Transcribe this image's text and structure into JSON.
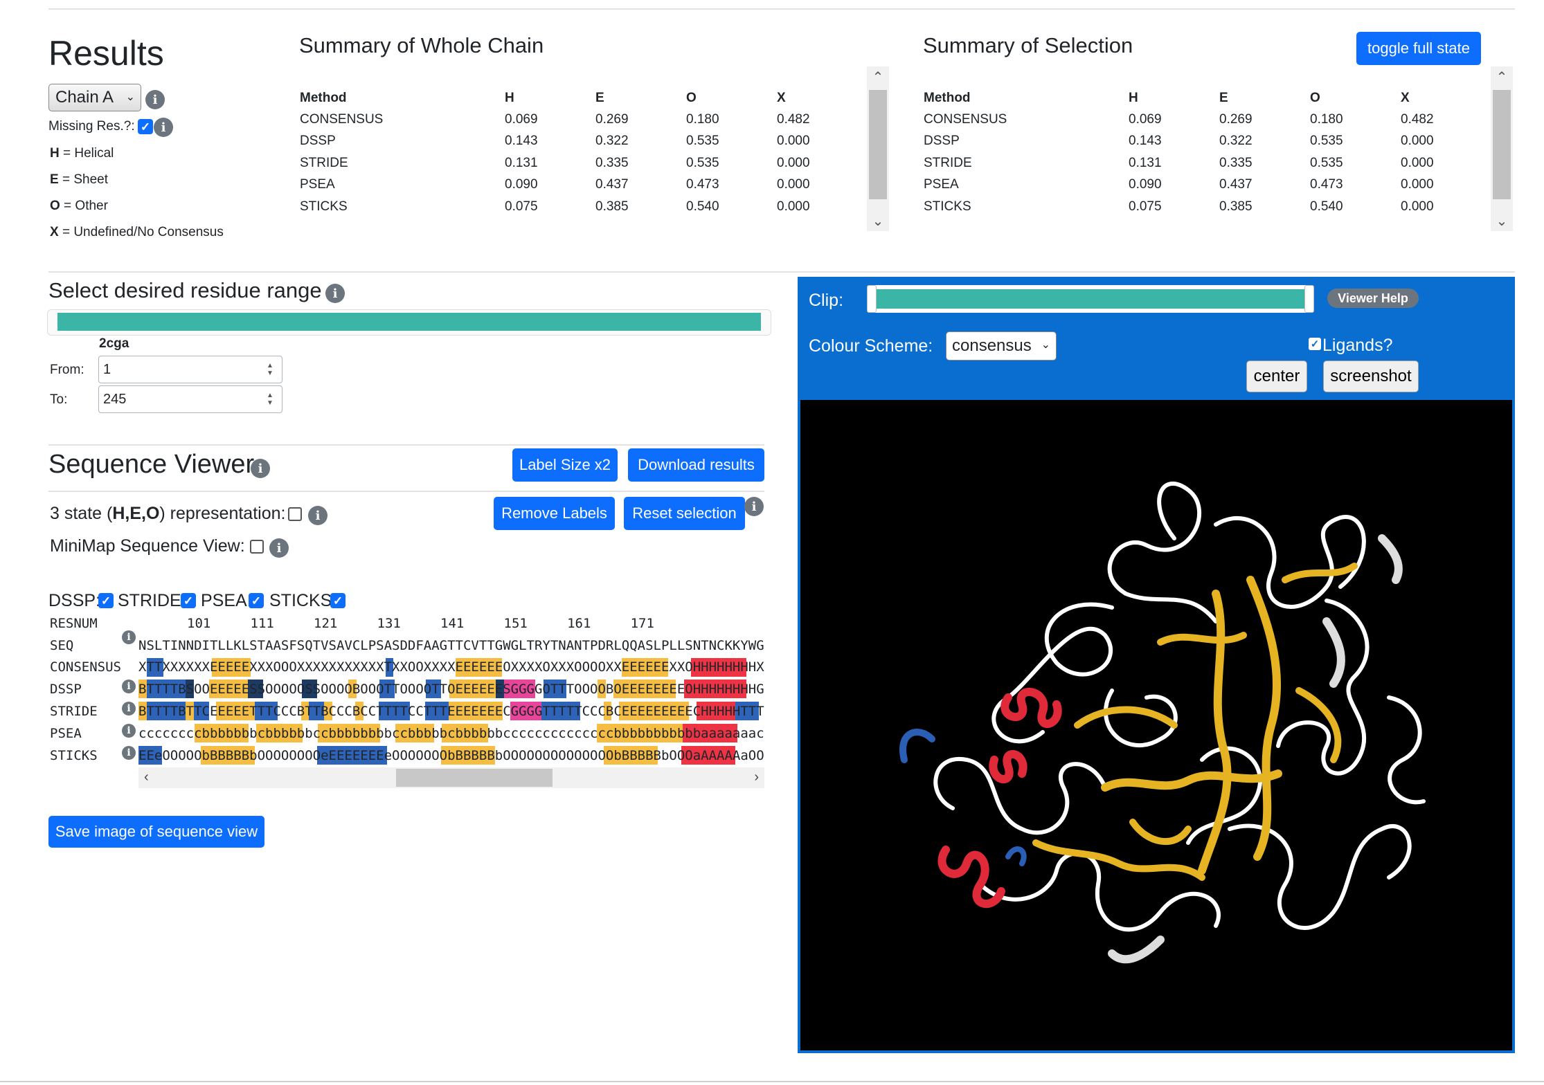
{
  "results": {
    "title": "Results",
    "chain_select": "Chain A",
    "missing_res_label": "Missing Res.?:",
    "legend": [
      {
        "key": "H",
        "text": " = Helical"
      },
      {
        "key": "E",
        "text": " = Sheet"
      },
      {
        "key": "O",
        "text": " = Other"
      },
      {
        "key": "X",
        "text": " = Undefined/No Consensus"
      }
    ]
  },
  "summary_whole": {
    "title": "Summary of Whole Chain",
    "headers": [
      "Method",
      "H",
      "E",
      "O",
      "X"
    ],
    "rows": [
      [
        "CONSENSUS",
        "0.069",
        "0.269",
        "0.180",
        "0.482"
      ],
      [
        "DSSP",
        "0.143",
        "0.322",
        "0.535",
        "0.000"
      ],
      [
        "STRIDE",
        "0.131",
        "0.335",
        "0.535",
        "0.000"
      ],
      [
        "PSEA",
        "0.090",
        "0.437",
        "0.473",
        "0.000"
      ],
      [
        "STICKS",
        "0.075",
        "0.385",
        "0.540",
        "0.000"
      ]
    ]
  },
  "summary_selection": {
    "title": "Summary of Selection",
    "toggle_label": "toggle full state",
    "headers": [
      "Method",
      "H",
      "E",
      "O",
      "X"
    ],
    "rows": [
      [
        "CONSENSUS",
        "0.069",
        "0.269",
        "0.180",
        "0.482"
      ],
      [
        "DSSP",
        "0.143",
        "0.322",
        "0.535",
        "0.000"
      ],
      [
        "STRIDE",
        "0.131",
        "0.335",
        "0.535",
        "0.000"
      ],
      [
        "PSEA",
        "0.090",
        "0.437",
        "0.473",
        "0.000"
      ],
      [
        "STICKS",
        "0.075",
        "0.385",
        "0.540",
        "0.000"
      ]
    ]
  },
  "range": {
    "title": "Select desired residue range",
    "chain_id": "2cga",
    "from_label": "From:",
    "from_value": "1",
    "to_label": "To:",
    "to_value": "245"
  },
  "sequence_viewer": {
    "title": "Sequence Viewer",
    "label_size_btn": "Label Size x2",
    "download_btn": "Download results",
    "three_state_prefix": "3 state (",
    "three_state_bold": "H,E,O",
    "three_state_suffix": ") representation:",
    "remove_labels_btn": "Remove Labels",
    "reset_selection_btn": "Reset selection",
    "minimap_label": "MiniMap Sequence View:",
    "method_toggles": [
      "DSSP:",
      "STRIDE:",
      "PSEA:",
      "STICKS:"
    ],
    "resnum_label": "RESNUM",
    "resnum_line": "101     111     121     131     141     151     161     171",
    "seq_label": "SEQ",
    "seq_line": "NSLTINNDITLLKLSTAASFSQTVSAVCLPSASDDFAAGTTCVTTGWGLTRYTNANTPDRLQQASLPLLSNTNCKKYWGT",
    "rows": [
      {
        "label": "CONSENSUS",
        "text": "XTTXXXXXXEEEEEXXXOOOXXXXXXXXXXXTXXOOXXXXEEEEEEOXXXXOXXXOOOOXXEEEEEEXXOHHHHHHHHXXX"
      },
      {
        "label": "DSSP",
        "text": "BTTTTBSOOEEEEESSOOOOOSSOOOOBOOOTTOOOOTTOEEEEEESGGGGOTTTOOOOBOEEEEEEEEOHHHHHHHHGG"
      },
      {
        "label": "STRIDE",
        "text": "BTTTTBTTCEEEEETTTCCCBTTBCCCBCCTTTTCCTTTEEEEEEECGGGGTTTTTCCCBCEEEEEEEEECHHHHHTTTGG"
      },
      {
        "label": "PSEA",
        "text": "ccccccccbbbbbbbcbbbbbbccbbbbbbbbccbbbbbcbbbbbbccccccccccccccbbbbbbbbbbbaaaaaaaccc"
      },
      {
        "label": "STICKS",
        "text": "EEeOOOOObBBBBBbOOOOOOOOeEEEEEEEeOOOOOOObBBBBBbOOOOOOOOOOOOOObBBBBBbOOOaAAAAAaOOO"
      }
    ],
    "save_image_btn": "Save image of sequence view"
  },
  "viewer": {
    "clip_label": "Clip:",
    "help_btn": "Viewer Help",
    "colour_label": "Colour Scheme:",
    "colour_value": "consensus",
    "ligands_label": "Ligands?",
    "center_btn": "center",
    "screenshot_btn": "screenshot"
  },
  "colors": {
    "primary": "#0d6efd",
    "helix": "#ee3344",
    "sheet": "#f5be42",
    "turn": "#2d63b8",
    "bridge_dark": "#1d3a63",
    "gap_3_10": "#e8459a",
    "range_bar": "#3bb5a5"
  }
}
